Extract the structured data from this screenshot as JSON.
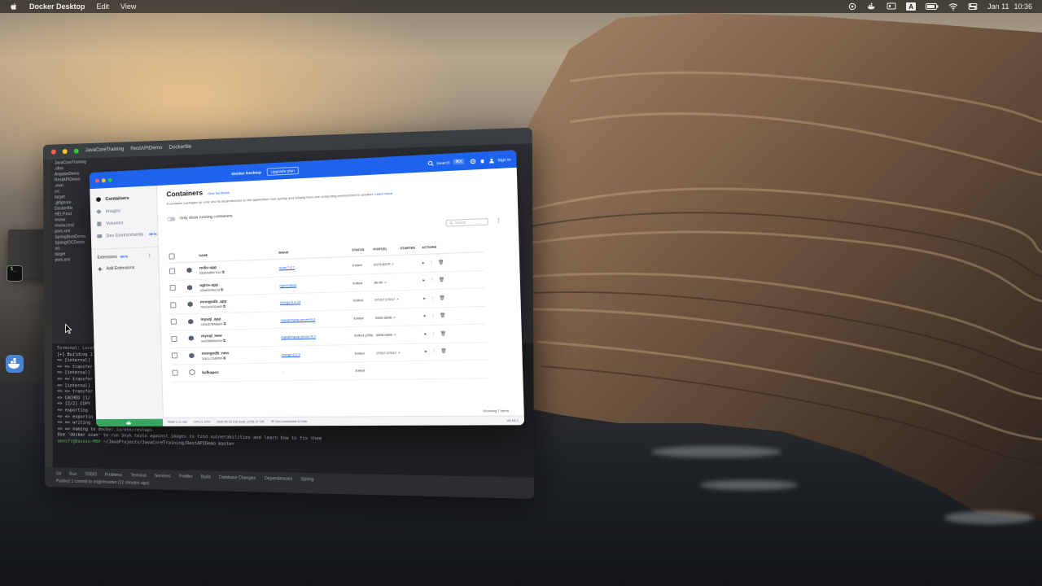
{
  "menubar": {
    "app_name": "Docker Desktop",
    "menus": [
      "Edit",
      "View"
    ],
    "date": "Jan 11",
    "time": "10:36",
    "status_icons": [
      "openai-icon",
      "docker-whale-icon",
      "airdrop-icon",
      "input-source-icon",
      "battery-icon",
      "wifi-icon",
      "control-center-icon"
    ],
    "input_source": "A"
  },
  "ide": {
    "project_title": "JavaCoreTraining",
    "breadcrumb": "RestAPIDemo",
    "file": "Dockerfile",
    "tree": [
      "JavaCoreTraining",
      ".idea",
      "AngularDemo",
      "RestAPIDemo",
      ".mvn",
      "src",
      "target",
      ".gitignore",
      "Dockerfile",
      "HELP.md",
      "mvnw",
      "mvnw.cmd",
      "pom.xml",
      "SpringBootDemo",
      "SpringIOCDemo",
      "src",
      "target",
      "pom.xml"
    ],
    "terminal_tabs": [
      "Terminal:",
      "Local"
    ],
    "terminal_lines": [
      "[+] Building 1",
      " => [internal]",
      " => => transfer",
      " => [internal]",
      " => => transfer",
      " => [internal]",
      " => => transfer",
      " => CACHED [1/",
      " => [2/2] COPY",
      " => exporting",
      " => => exportin",
      " => => writing",
      " => => naming to docker.io/ann/restapi"
    ],
    "terminal_hint": "Use 'docker scan' to run Snyk tests against images to find vulnerabilities and learn how to fix them",
    "prompt_user": "annsfr@Dasein-MBP",
    "prompt_path": "~/JavaProjects/JavaCoreTraining/RestAPIDemo",
    "prompt_branch": "master",
    "bottom_tabs": [
      "Git",
      "Run",
      "TODO",
      "Problems",
      "Terminal",
      "Services",
      "Profiler",
      "Build",
      "Database Changes",
      "Dependencies",
      "Spring"
    ],
    "status_line": "Pushed 1 commit to origin/master (12 minutes ago)"
  },
  "docker": {
    "topbar": {
      "brand": "Docker Desktop",
      "upgrade": "Upgrade plan",
      "search": "Search",
      "shortcut": "⌘K",
      "signin": "Sign in"
    },
    "sidebar": {
      "items": [
        {
          "label": "Containers",
          "icon": "containers-icon"
        },
        {
          "label": "Images",
          "icon": "images-icon"
        },
        {
          "label": "Volumes",
          "icon": "volumes-icon"
        },
        {
          "label": "Dev Environments",
          "icon": "dev-env-icon",
          "badge": "BETA"
        }
      ],
      "extensions_label": "Extensions",
      "extensions_badge": "BETA",
      "add_extensions": "Add Extensions"
    },
    "main": {
      "title": "Containers",
      "feedback": "Give feedback",
      "description": "A container packages up code and its dependencies so the application runs quickly and reliably from one computing environment to another.",
      "learn_more": "Learn more",
      "toggle_label": "Only show running containers",
      "search_placeholder": "Search",
      "columns": [
        "",
        "",
        "NAME",
        "IMAGE",
        "STATUS",
        "PORT(S)",
        "STARTED",
        "ACTIONS"
      ],
      "rows": [
        {
          "name": "redis-app",
          "id": "b5664d667a1d",
          "image": "redis:7.0.7",
          "status": "Exited",
          "ports": "6379:6379"
        },
        {
          "name": "nginx-app",
          "id": "42b8f1f40e2d",
          "image": "nginx:latest",
          "status": "Exited",
          "ports": "80:80"
        },
        {
          "name": "mongodb_app",
          "id": "7bb1a9431ad5",
          "image": "mongo:6.0.14",
          "status": "Exited",
          "ports": "27017:27017"
        },
        {
          "name": "mysql_app",
          "id": "195d57848624",
          "image": "mysql/mysql-server:8.0",
          "status": "Exited",
          "ports": "3306:3306"
        },
        {
          "name": "mysql_new",
          "id": "e82286f4d090",
          "image": "mysql/mysql-server:8.0",
          "status": "Exited (255)",
          "ports": "3306:3306"
        },
        {
          "name": "mongodb_new",
          "id": "11b1c23d8f8b",
          "image": "mongo:6.0.3",
          "status": "Exited",
          "ports": "27017:27017"
        },
        {
          "name": "kafkapoc",
          "id": "",
          "image": "-",
          "status": "Exited",
          "ports": ""
        }
      ],
      "showing": "Showing 7 items"
    },
    "statusbar": {
      "ram": "RAM 3.11 GB",
      "cpu": "CPU 0.10%",
      "disk": "Disk 46.19 GB avail. of 58.37 GB",
      "hub": "Not connected to Hub",
      "version": "v4.16.1"
    },
    "colors": {
      "accent": "#1d63ed",
      "sidebar_footer": "#36a660"
    }
  }
}
